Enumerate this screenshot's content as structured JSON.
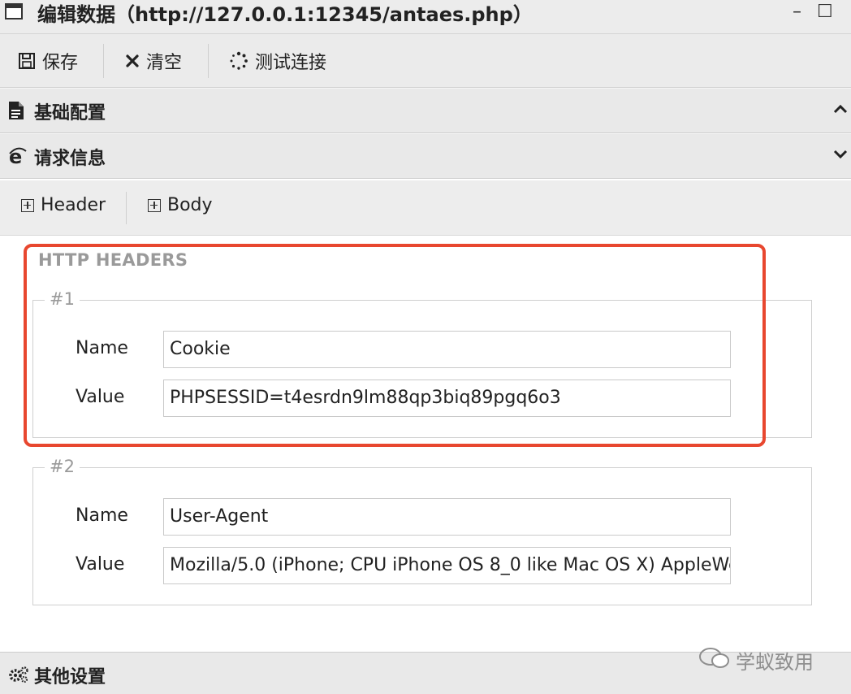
{
  "window": {
    "title": "编辑数据（http://127.0.0.1:12345/antaes.php）",
    "minimize": "–",
    "maximize": "☐"
  },
  "toolbar": {
    "save_label": "保存",
    "clear_label": "清空",
    "test_label": "测试连接"
  },
  "sections": {
    "basic": "基础配置",
    "request": "请求信息",
    "other": "其他设置"
  },
  "tabs": {
    "header": "Header",
    "body": "Body"
  },
  "headers": {
    "title": "HTTP HEADERS",
    "items": [
      {
        "legend": "#1",
        "name_label": "Name",
        "value_label": "Value",
        "name": "Cookie",
        "value": "PHPSESSID=t4esrdn9lm88qp3biq89pgq6o3"
      },
      {
        "legend": "#2",
        "name_label": "Name",
        "value_label": "Value",
        "name": "User-Agent",
        "value": "Mozilla/5.0 (iPhone; CPU iPhone OS 8_0 like Mac OS X) AppleWe"
      }
    ]
  },
  "watermark": "学蚁致用",
  "colors": {
    "highlight": "#e8472f",
    "muted": "#9a9a9a"
  }
}
